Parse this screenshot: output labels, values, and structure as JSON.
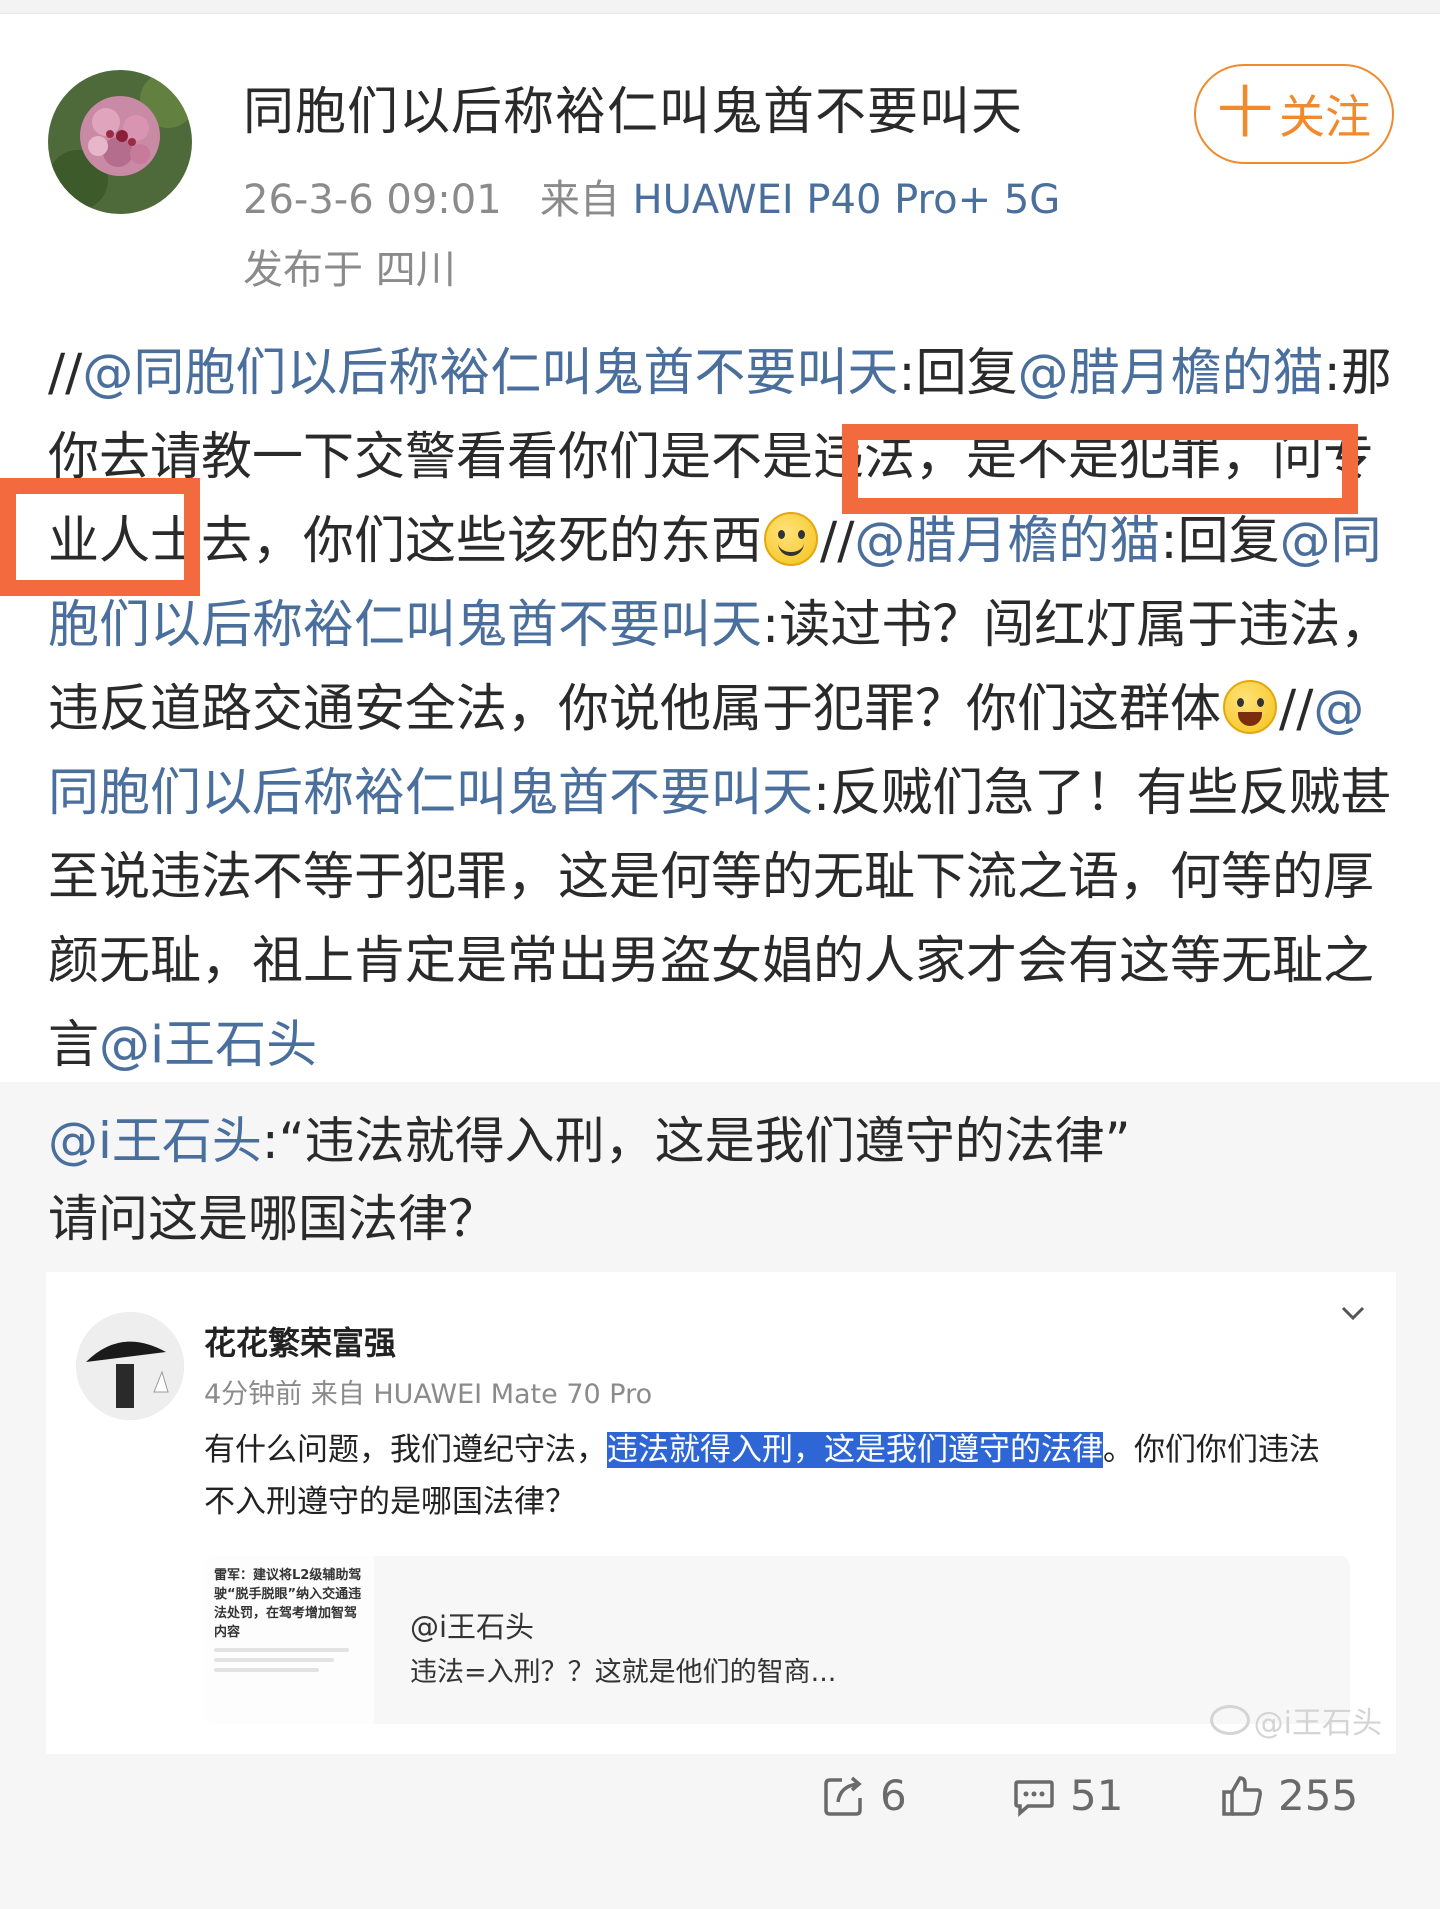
{
  "post": {
    "author": "同胞们以后称裕仁叫鬼酋不要叫天",
    "follow_label": "关注",
    "follow_plus": "十",
    "time": "26-3-6 09:01",
    "source_prefix": "来自",
    "device": "HUAWEI P40 Pro+ 5G",
    "location": "发布于 四川",
    "segments": [
      {
        "t": "//"
      },
      {
        "t": "@同胞们以后称裕仁叫鬼酋不要叫天",
        "m": true
      },
      {
        "t": ":回复"
      },
      {
        "t": "@腊月檐的猫",
        "m": true
      },
      {
        "t": ":那你去请教一下交警看看你们是不是违法，是不是犯罪，问专业人士去，你们这些该死的东西"
      },
      {
        "e": "smile"
      },
      {
        "t": "//"
      },
      {
        "t": "@腊月檐的猫",
        "m": true
      },
      {
        "t": ":回复"
      },
      {
        "t": "@同胞们以后称裕仁叫鬼酋不要叫天",
        "m": true
      },
      {
        "t": ":读过书？闯红灯属于违法，违反道路交通安全法，你说他属于犯罪？你们这群体"
      },
      {
        "e": "cry"
      },
      {
        "t": "//"
      },
      {
        "t": "@同胞们以后称裕仁叫鬼酋不要叫天",
        "m": true
      },
      {
        "t": ":反贼们急了！有些反贼甚至说违法不等于犯罪，这是何等的无耻下流之语，何等的厚颜无耻，祖上肯定是常出男盗女娼的人家才会有这等无耻之言"
      },
      {
        "t": "@i王石头",
        "m": true
      }
    ]
  },
  "retweet": {
    "mention": "@i王石头",
    "text": ":“违法就得入刑，这是我们遵守的法律”",
    "question": "请问这是哪国法律？",
    "embed": {
      "name": "花花繁荣富强",
      "meta": "4分钟前  来自 HUAWEI Mate 70 Pro",
      "text_before": "有什么问题，我们遵纪守法，",
      "text_selected": "违法就得入刑，这是我们遵守的法律",
      "text_after": "。你们你们违法不入刑遵守的是哪国法律？",
      "quote_user": "@i王石头",
      "quote_snippet": "违法=入刑？？这就是他们的智商...",
      "thumb_title": "雷军：建议将L2级辅助驾驶“脱手脱眼”纳入交通违法处罚，在驾考增加智驾内容",
      "watermark": "@i王石头"
    }
  },
  "actions": {
    "repost_count": "6",
    "comment_count": "51",
    "like_count": "255"
  },
  "colors": {
    "mention": "#4a6f9c",
    "follow": "#f08a2e",
    "highlight_box": "#f26a3e",
    "selection": "#2f66d6"
  }
}
